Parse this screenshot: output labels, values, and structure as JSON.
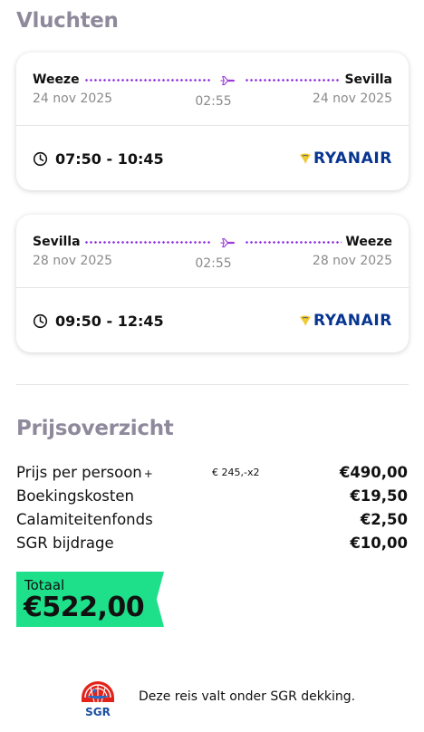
{
  "flights_title": "Vluchten",
  "flights": [
    {
      "from_city": "Weeze",
      "to_city": "Sevilla",
      "from_date": "24 nov 2025",
      "to_date": "24 nov 2025",
      "duration": "02:55",
      "times": "07:50 - 10:45",
      "airline": "RYANAIR"
    },
    {
      "from_city": "Sevilla",
      "to_city": "Weeze",
      "from_date": "28 nov 2025",
      "to_date": "28 nov 2025",
      "duration": "02:55",
      "times": "09:50 - 12:45",
      "airline": "RYANAIR"
    }
  ],
  "price_title": "Prijsoverzicht",
  "price_rows": [
    {
      "label": "Prijs per persoon",
      "plus": "+",
      "note": "€ 245,-x2",
      "value": "€490,00"
    },
    {
      "label": "Boekingskosten",
      "value": "€19,50"
    },
    {
      "label": "Calamiteitenfonds",
      "value": "€2,50"
    },
    {
      "label": "SGR bijdrage",
      "value": "€10,00"
    }
  ],
  "total": {
    "label": "Totaal",
    "value": "€522,00"
  },
  "sgr": {
    "text": "Deze reis valt onder SGR dekking.",
    "logo_text": "SGR"
  },
  "colors": {
    "accent_green": "#1ee08a",
    "route_dots": "#8a2be2",
    "ryanair_blue": "#073590",
    "ryanair_gold": "#f1c933",
    "title_gray": "#8e8a9c"
  },
  "icons": [
    "plane-icon",
    "clock-icon",
    "ryanair-harp-icon",
    "sgr-globe-icon"
  ]
}
